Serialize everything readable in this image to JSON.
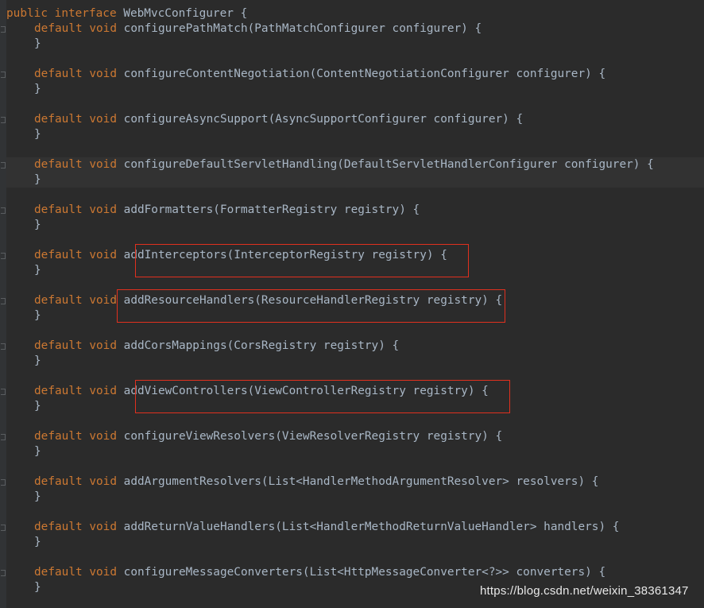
{
  "editor": {
    "language": "java",
    "theme_colors": {
      "background": "#2b2b2b",
      "keyword": "#cc7832",
      "text": "#a9b7c6",
      "highlight_box": "#e0301e"
    },
    "header": {
      "kw1": "public",
      "kw2": "interface",
      "rest": " WebMvcConfigurer {"
    },
    "kw_default": "default",
    "kw_void": "void",
    "close_brace": "}",
    "methods": [
      {
        "sig": "configurePathMatch(PathMatchConfigurer configurer) {",
        "highlighted": false
      },
      {
        "sig": "configureContentNegotiation(ContentNegotiationConfigurer configurer) {",
        "highlighted": false
      },
      {
        "sig": "configureAsyncSupport(AsyncSupportConfigurer configurer) {",
        "highlighted": false
      },
      {
        "sig": "configureDefaultServletHandling(DefaultServletHandlerConfigurer configurer) {",
        "highlighted": false
      },
      {
        "sig": "addFormatters(FormatterRegistry registry) {",
        "highlighted": false
      },
      {
        "sig": "addInterceptors(InterceptorRegistry registry) {",
        "highlighted": true
      },
      {
        "sig": "addResourceHandlers(ResourceHandlerRegistry registry) {",
        "highlighted": true
      },
      {
        "sig": "addCorsMappings(CorsRegistry registry) {",
        "highlighted": false
      },
      {
        "sig": "addViewControllers(ViewControllerRegistry registry) {",
        "highlighted": true
      },
      {
        "sig": "configureViewResolvers(ViewResolverRegistry registry) {",
        "highlighted": false
      },
      {
        "sig": "addArgumentResolvers(List<HandlerMethodArgumentResolver> resolvers) {",
        "highlighted": false
      },
      {
        "sig": "addReturnValueHandlers(List<HandlerMethodReturnValueHandler> handlers) {",
        "highlighted": false
      },
      {
        "sig": "configureMessageConverters(List<HttpMessageConverter<?>> converters) {",
        "highlighted": false
      }
    ]
  },
  "watermark": "https://blog.csdn.net/weixin_38361347"
}
